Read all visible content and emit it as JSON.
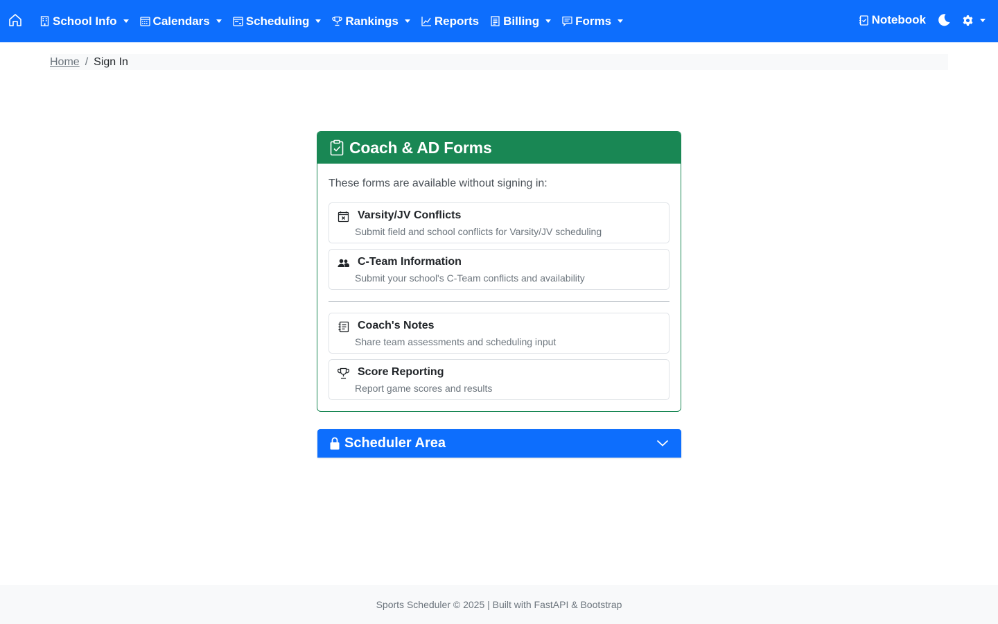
{
  "navbar": {
    "home_icon": "house-icon",
    "items": [
      {
        "label": "School Info",
        "icon": "building-icon",
        "dropdown": true
      },
      {
        "label": "Calendars",
        "icon": "calendar-grid-icon",
        "dropdown": true
      },
      {
        "label": "Scheduling",
        "icon": "calendar-range-icon",
        "dropdown": true
      },
      {
        "label": "Rankings",
        "icon": "trophy-icon",
        "dropdown": true
      },
      {
        "label": "Reports",
        "icon": "graph-up-icon",
        "dropdown": false
      },
      {
        "label": "Billing",
        "icon": "receipt-icon",
        "dropdown": true
      },
      {
        "label": "Forms",
        "icon": "chat-square-text-icon",
        "dropdown": true
      }
    ],
    "notebook_label": "Notebook",
    "notebook_icon": "journal-check-icon",
    "theme_icon": "moon-icon",
    "settings_icon": "gear-icon"
  },
  "breadcrumb": {
    "home": "Home",
    "separator": "/",
    "current": "Sign In"
  },
  "forms_card": {
    "title": "Coach & AD Forms",
    "title_icon": "clipboard-check-icon",
    "intro": "These forms are available without signing in:",
    "items": [
      {
        "title": "Varsity/JV Conflicts",
        "description": "Submit field and school conflicts for Varsity/JV scheduling",
        "icon": "calendar-x-icon"
      },
      {
        "title": "C-Team Information",
        "description": "Submit your school's C-Team conflicts and availability",
        "icon": "people-icon"
      },
      {
        "title": "Coach's Notes",
        "description": "Share team assessments and scheduling input",
        "icon": "journal-text-icon"
      },
      {
        "title": "Score Reporting",
        "description": "Report game scores and results",
        "icon": "trophy-icon"
      }
    ]
  },
  "scheduler_area": {
    "title": "Scheduler Area",
    "icon": "lock-icon",
    "toggle_icon": "chevron-down-icon"
  },
  "footer": {
    "text": "Sports Scheduler © 2025 | Built with FastAPI & Bootstrap"
  },
  "colors": {
    "primary": "#0d6efd",
    "success": "#198754",
    "muted": "#6c757d",
    "light": "#f8f9fa"
  }
}
